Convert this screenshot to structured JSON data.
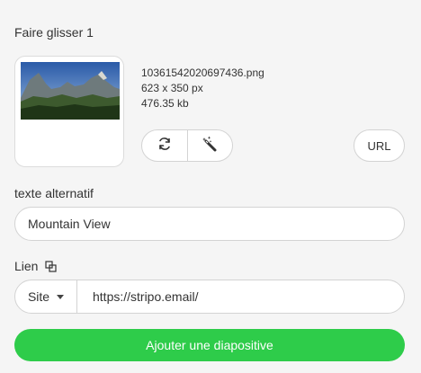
{
  "section": {
    "title": "Faire glisser 1"
  },
  "image": {
    "filename": "10361542020697436.png",
    "dimensions": "623 x 350 px",
    "size": "476.35 kb",
    "replace_icon": "refresh-icon",
    "edit_icon": "magic-wand-icon",
    "url_label": "URL"
  },
  "alt_text": {
    "label": "texte alternatif",
    "value": "Mountain View"
  },
  "link": {
    "label": "Lien",
    "label_icon": "copy-icon",
    "type": "Site",
    "url": "https://stripo.email/"
  },
  "actions": {
    "add_slide_label": "Ajouter une diapositive"
  },
  "colors": {
    "primary": "#2ecc4a",
    "border": "#d3d3d3",
    "background": "#f5f5f5"
  }
}
